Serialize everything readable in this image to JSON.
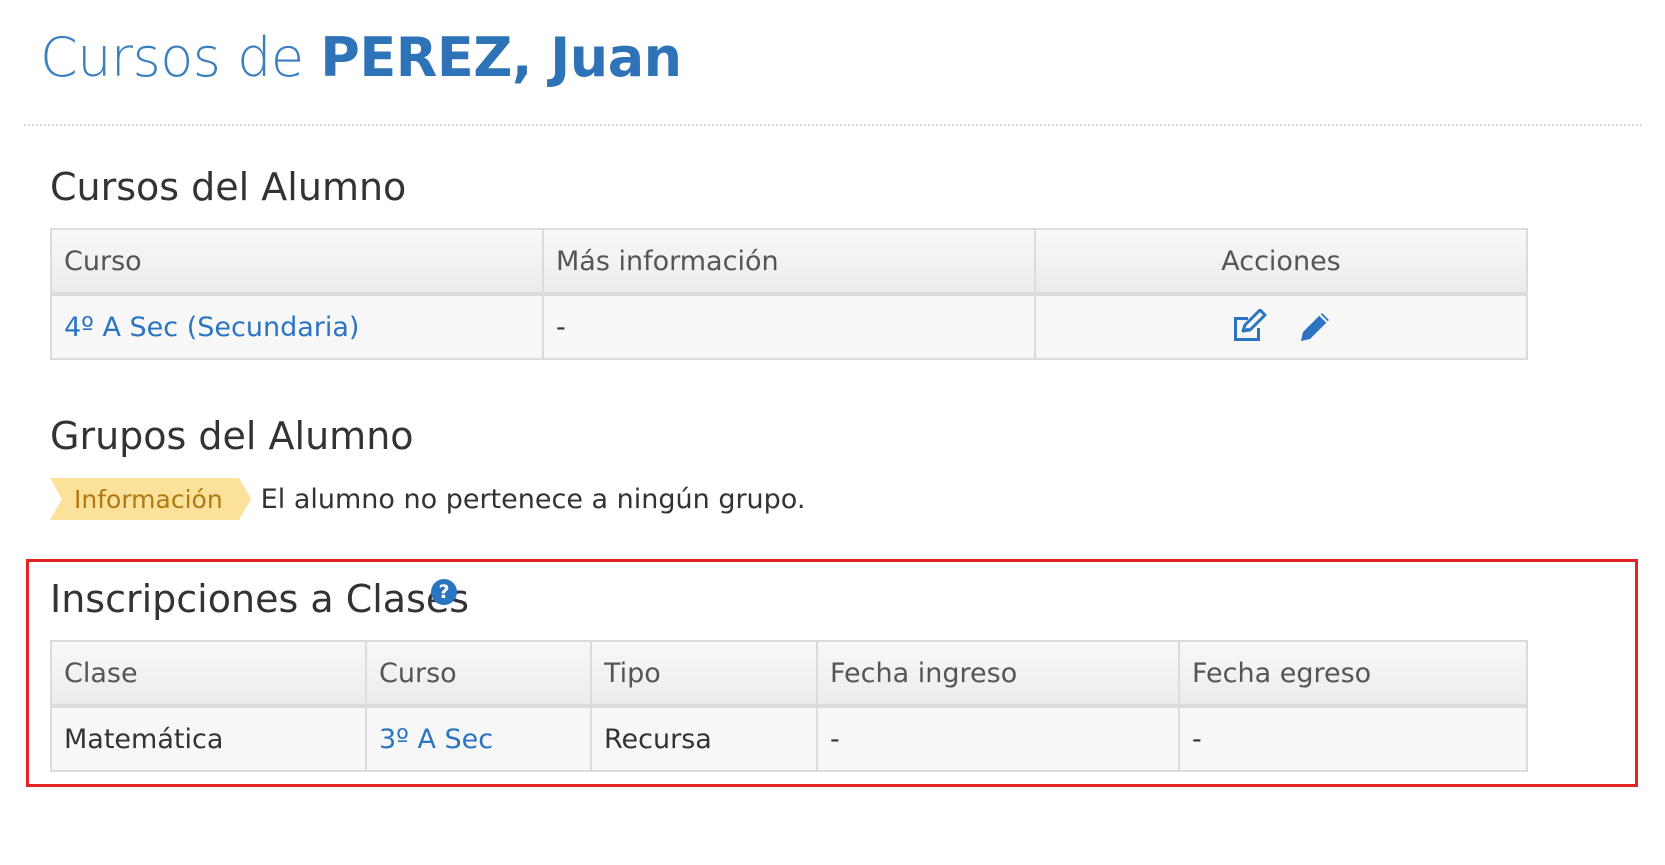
{
  "header": {
    "title_prefix": "Cursos de ",
    "student_name": "PEREZ, Juan"
  },
  "courses_section": {
    "heading": "Cursos del Alumno",
    "columns": [
      "Curso",
      "Más información",
      "Acciones"
    ],
    "rows": [
      {
        "curso": "4º A Sec (Secundaria)",
        "mas_info": "-",
        "actions": [
          "edit-square-icon",
          "pencil-icon"
        ]
      }
    ]
  },
  "groups_section": {
    "heading": "Grupos del Alumno",
    "badge": "Información",
    "message": "El alumno no pertenece a ningún grupo."
  },
  "enrollments_section": {
    "heading": "Inscripciones a Clases",
    "help_icon": "?",
    "columns": [
      "Clase",
      "Curso",
      "Tipo",
      "Fecha ingreso",
      "Fecha egreso"
    ],
    "rows": [
      {
        "clase": "Matemática",
        "curso": "3º A Sec",
        "tipo": "Recursa",
        "fecha_ingreso": "-",
        "fecha_egreso": "-"
      }
    ]
  },
  "colors": {
    "link": "#2a74c2",
    "title": "#3a7fc0",
    "badge_bg": "#fbe19a",
    "badge_text": "#b07a12",
    "highlight": "#e32424"
  }
}
